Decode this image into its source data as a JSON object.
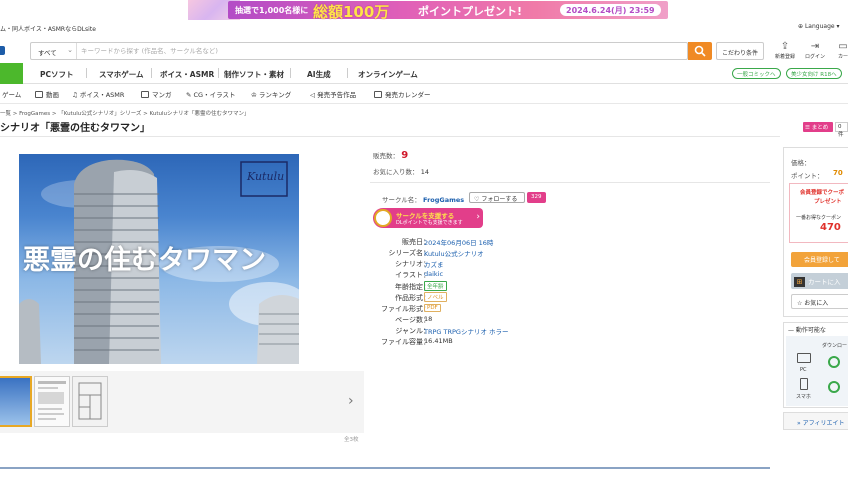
{
  "banner": {
    "text1": "抽選で1,000名様に",
    "text2": "総額100万",
    "text3": "ポイントプレゼント!",
    "date": "2024.6.24(月) 23:59"
  },
  "topbar": {
    "breadcrumb": "ム・同人ボイス・ASMRならDLsite",
    "language": "Language"
  },
  "search": {
    "category": "すべて",
    "placeholder": "キーワードから探す (作品名、サークル名など)",
    "value": "",
    "advanced": "こだわり条件"
  },
  "header_icons": [
    {
      "icon": "new-arrivals-icon",
      "label": "新着登録"
    },
    {
      "icon": "login-icon",
      "label": "ログイン"
    },
    {
      "icon": "cart-icon",
      "label": "カー"
    }
  ],
  "category_nav": {
    "items": [
      "PCソフト",
      "スマホゲーム",
      "ボイス・ASMR",
      "制作ソフト・素材",
      "AI生成",
      "オンラインゲーム"
    ],
    "pill1": "一般コミックへ",
    "pill2": "美少女向け R18へ"
  },
  "sub_nav": {
    "items": [
      "ゲーム",
      "動画",
      "ボイス・ASMR",
      "マンガ",
      "CG・イラスト",
      "ランキング",
      "発売予告作品",
      "発売カレンダー"
    ]
  },
  "breadcrumb": [
    "一覧",
    "FrogGames",
    "「Kutulu公式シナリオ」シリーズ",
    "Kutuluシナリオ「悪霊の住むタワマン」"
  ],
  "product": {
    "title": "シナリオ「悪霊の住むタワマン」",
    "matome": "まとめ",
    "matome_count": "0件",
    "cover_text": "悪霊の住むタワマン",
    "cover_logo": "Kutulu",
    "image_count": "全3枚",
    "sales_label": "販売数：",
    "sales": "9",
    "fav_label": "お気に入り数：",
    "fav": "14",
    "circle_label": "サークル名：",
    "circle": "FrogGames",
    "follow": "フォローする",
    "followers": "329",
    "support_l1": "サークルを支援する",
    "support_l2": "DLポイントでも支援できます",
    "details": [
      {
        "label": "販売日：",
        "value": "2024年06月06日 16時"
      },
      {
        "label": "シリーズ名：",
        "value": "Kutulu公式シナリオ"
      },
      {
        "label": "シナリオ：",
        "value": "カズま"
      },
      {
        "label": "イラスト：",
        "value": "daikic"
      },
      {
        "label": "年齢指定：",
        "value": "全年齢"
      },
      {
        "label": "作品形式：",
        "value": "ノベル"
      },
      {
        "label": "ファイル形式：",
        "value": "PDF"
      },
      {
        "label": "ページ数：",
        "value": "18"
      },
      {
        "label": "ジャンル：",
        "value": "TRPG  TRPGシナリオ  ホラー"
      },
      {
        "label": "ファイル容量：",
        "value": "16.41MB"
      }
    ]
  },
  "right_panel": {
    "price_label": "価格：",
    "point_label": "ポイント：",
    "point_value": "70",
    "promo1": "会員登録でクーポ",
    "promo2": "プレゼント",
    "coupon_label": "一番お得なクーポン",
    "coupon_value": "470",
    "member_btn": "会員登録して",
    "cart_btn": "カートに入",
    "fav_btn": "お気に入",
    "compat_title": "動作可能な",
    "download_label": "ダウンロー",
    "pc_label": "PC",
    "phone_label": "スマホ",
    "affiliate": "アフィリエイト"
  }
}
